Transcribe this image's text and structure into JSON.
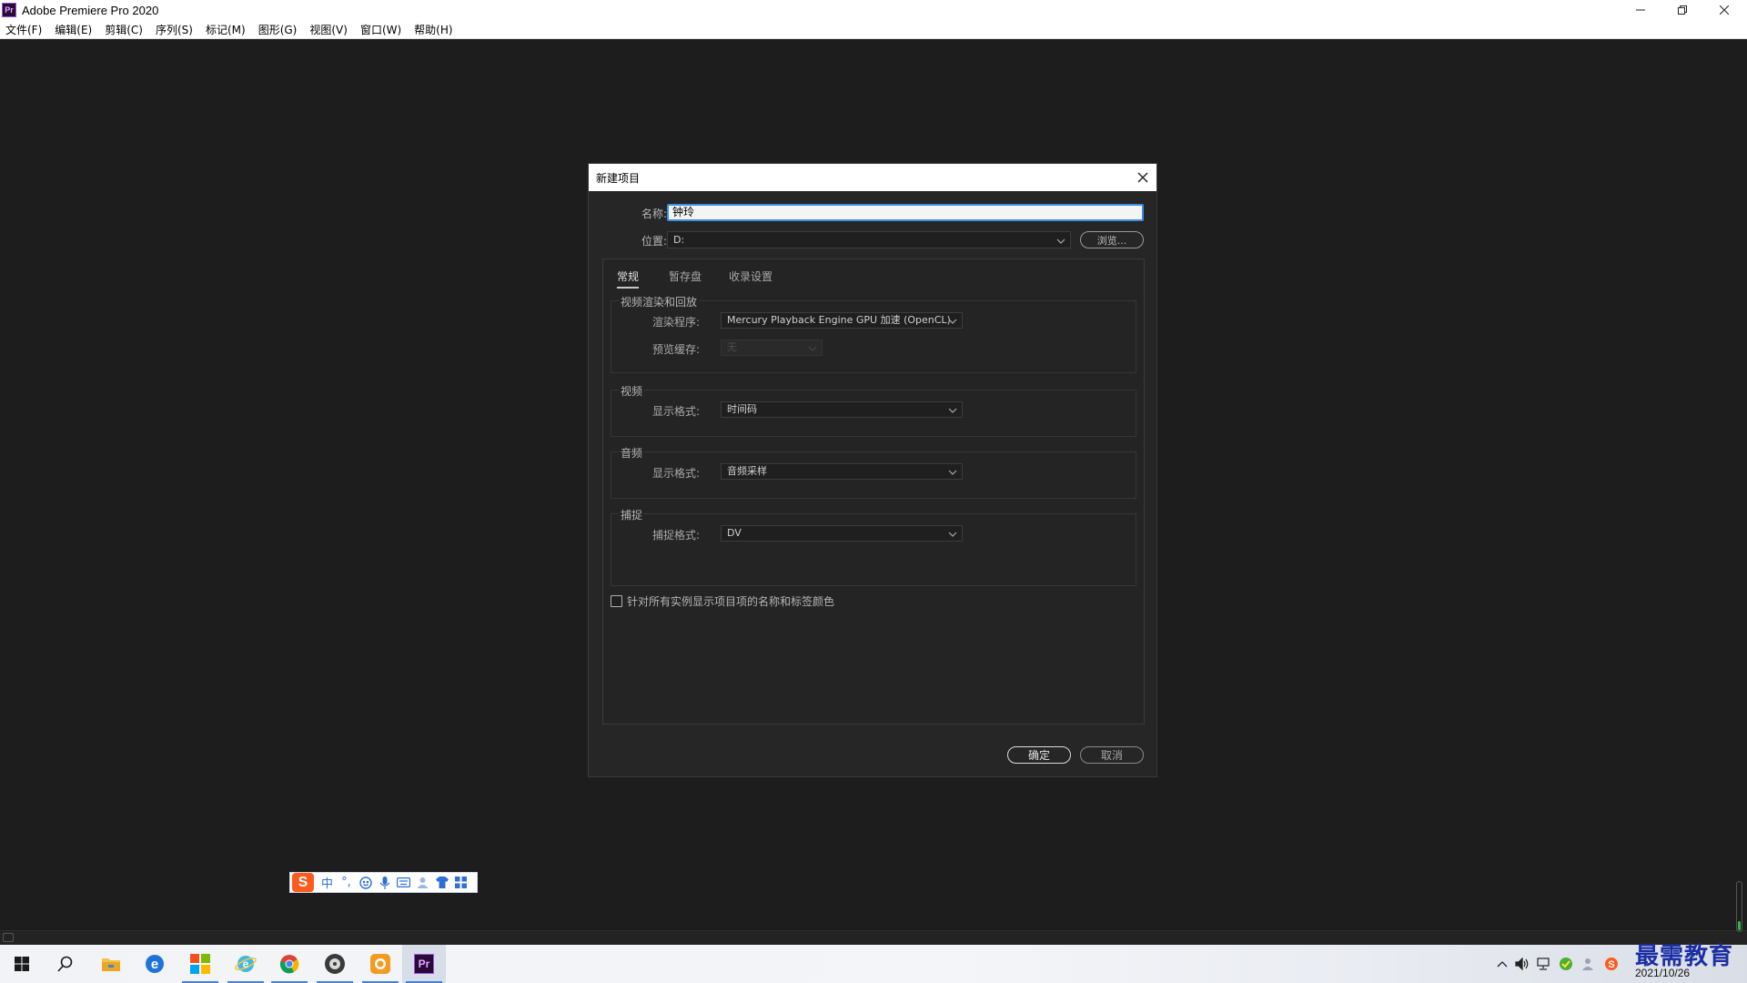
{
  "window": {
    "title": "Adobe Premiere Pro 2020",
    "icon_text": "Pr"
  },
  "menu": [
    "文件(F)",
    "编辑(E)",
    "剪辑(C)",
    "序列(S)",
    "标记(M)",
    "图形(G)",
    "视图(V)",
    "窗口(W)",
    "帮助(H)"
  ],
  "dialog": {
    "title": "新建项目",
    "name_label": "名称:",
    "name_value": "钟玲",
    "location_label": "位置:",
    "location_value": "D:",
    "browse_label": "浏览...",
    "tabs": [
      "常规",
      "暂存盘",
      "收录设置"
    ],
    "render_group": {
      "title": "视频渲染和回放",
      "renderer_label": "渲染程序:",
      "renderer_value": "Mercury Playback Engine GPU 加速 (OpenCL)",
      "preview_cache_label": "预览缓存:",
      "preview_cache_value": "无"
    },
    "video_group": {
      "title": "视频",
      "format_label": "显示格式:",
      "format_value": "时间码"
    },
    "audio_group": {
      "title": "音频",
      "format_label": "显示格式:",
      "format_value": "音频采样"
    },
    "capture_group": {
      "title": "捕捉",
      "format_label": "捕捉格式:",
      "format_value": "DV"
    },
    "checkbox_label": "针对所有实例显示项目项的名称和标签颜色",
    "ok_label": "确定",
    "cancel_label": "取消"
  },
  "ime": {
    "logo": "S",
    "mode": "中",
    "punct": "°,"
  },
  "taskbar": {
    "date": "2021/10/26",
    "premiere_label": "Pr"
  },
  "watermark": "最需教育"
}
